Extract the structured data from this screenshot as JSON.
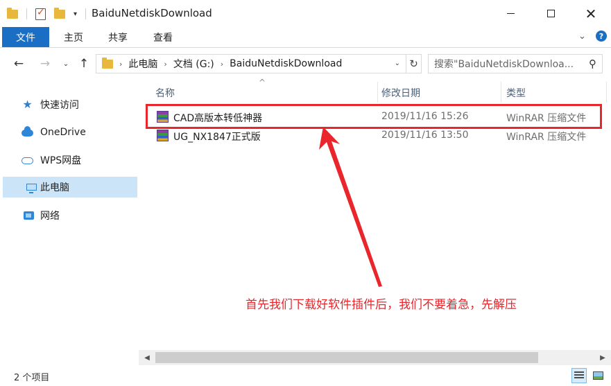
{
  "window": {
    "title": "BaiduNetdiskDownload"
  },
  "ribbon": {
    "tabs": [
      {
        "label": "文件"
      },
      {
        "label": "主页"
      },
      {
        "label": "共享"
      },
      {
        "label": "查看"
      }
    ]
  },
  "address": {
    "crumbs": [
      "此电脑",
      "文档 (G:)",
      "BaiduNetdiskDownload"
    ]
  },
  "search": {
    "placeholder": "搜索\"BaiduNetdiskDownloa..."
  },
  "sidebar": {
    "items": [
      {
        "label": "快速访问",
        "icon": "star-icon",
        "selected": false
      },
      {
        "label": "OneDrive",
        "icon": "cloud-icon",
        "selected": false
      },
      {
        "label": "WPS网盘",
        "icon": "cloud-outline-icon",
        "selected": false
      },
      {
        "label": "此电脑",
        "icon": "computer-icon",
        "selected": true
      },
      {
        "label": "网络",
        "icon": "network-icon",
        "selected": false
      }
    ]
  },
  "columns": {
    "name": "名称",
    "date": "修改日期",
    "type": "类型"
  },
  "files": [
    {
      "name": "CAD高版本转低神器",
      "date": "2019/11/16 15:26",
      "type": "WinRAR 压缩文件",
      "icon": "winrar-archive-icon",
      "highlighted": true
    },
    {
      "name": "UG_NX1847正式版",
      "date": "2019/11/16 13:50",
      "type": "WinRAR 压缩文件",
      "icon": "winrar-archive-icon",
      "highlighted": false
    }
  ],
  "annotation": {
    "text": "首先我们下载好软件插件后，我们不要着急，先解压",
    "color": "#e8262b"
  },
  "status": {
    "item_count": "2 个项目"
  },
  "colors": {
    "accent": "#1a6fc4",
    "selection": "#cce4f7",
    "annotation_red": "#e8262b"
  }
}
